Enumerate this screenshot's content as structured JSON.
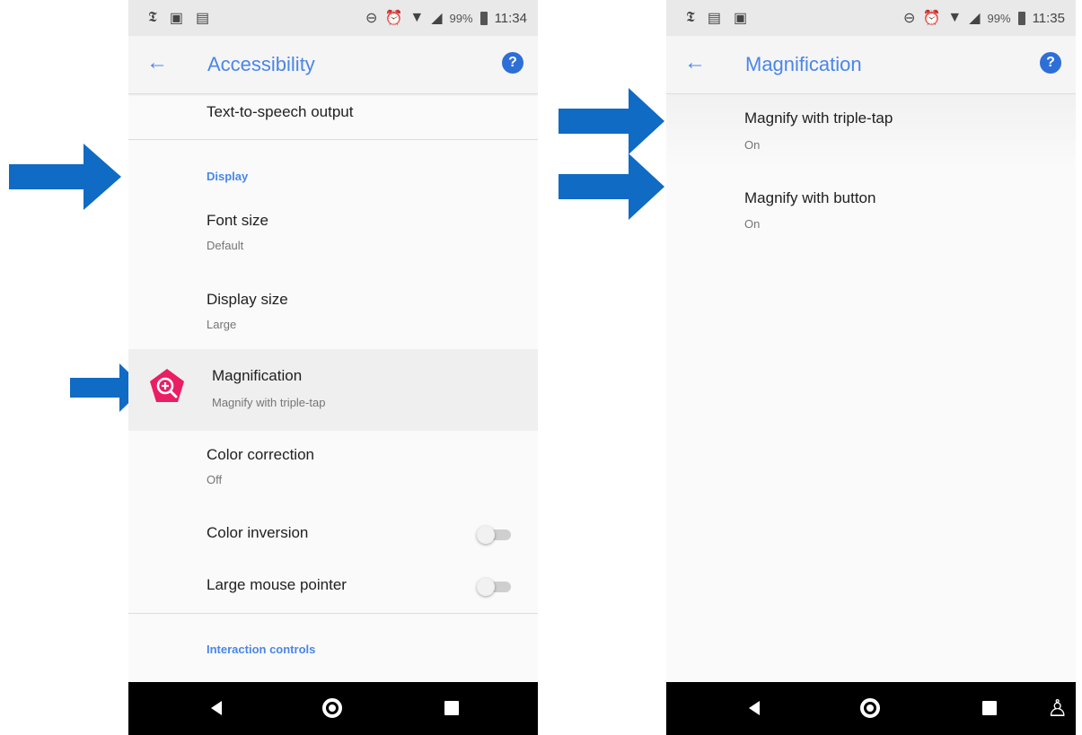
{
  "left": {
    "status": {
      "percent": "99%",
      "time": "11:34"
    },
    "appbar": {
      "title": "Accessibility"
    },
    "items": {
      "tts": "Text-to-speech output",
      "display_header": "Display",
      "font_size": {
        "title": "Font size",
        "sub": "Default"
      },
      "display_size": {
        "title": "Display size",
        "sub": "Large"
      },
      "magnification": {
        "title": "Magnification",
        "sub": "Magnify with triple-tap"
      },
      "color_correction": {
        "title": "Color correction",
        "sub": "Off"
      },
      "color_inversion": {
        "title": "Color inversion",
        "on": false
      },
      "large_pointer": {
        "title": "Large mouse pointer",
        "on": false
      },
      "interaction_header": "Interaction controls"
    }
  },
  "right": {
    "status": {
      "percent": "99%",
      "time": "11:35"
    },
    "appbar": {
      "title": "Magnification"
    },
    "items": {
      "triple_tap": {
        "title": "Magnify with triple-tap",
        "sub": "On"
      },
      "button": {
        "title": "Magnify with button",
        "sub": "On"
      }
    }
  },
  "colors": {
    "accent": "#4a86e8",
    "arrow": "#0f6bc4",
    "magnify_icon": "#e91e63"
  },
  "icons": [
    "back-arrow-icon",
    "help-icon",
    "magnify-icon",
    "nav-back-icon",
    "nav-home-icon",
    "nav-recent-icon",
    "accessibility-icon"
  ]
}
